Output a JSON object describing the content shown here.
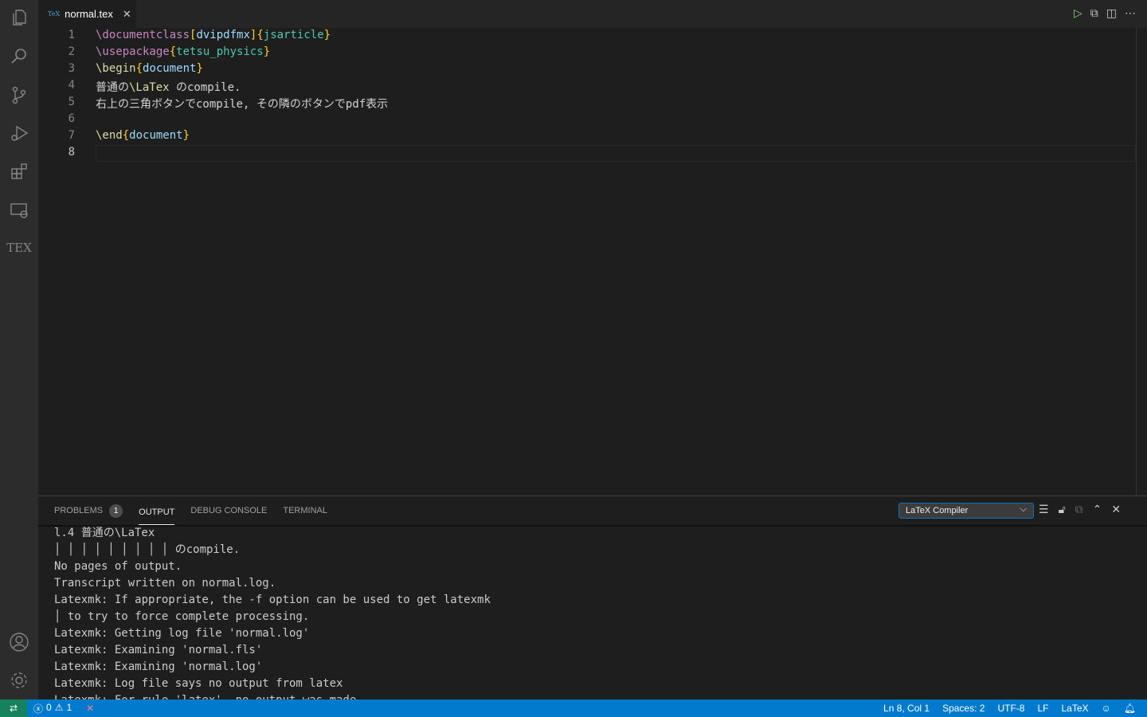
{
  "activity_bar": {
    "items": [
      "files-icon",
      "search-icon",
      "source-control-icon",
      "run-debug-icon",
      "extensions-icon",
      "remote-explorer-icon",
      "tex-icon"
    ],
    "bottom": [
      "account-icon",
      "settings-gear-icon"
    ],
    "tex_label": "TEX"
  },
  "tab": {
    "label": "normal.tex",
    "icon_text": "TeX"
  },
  "editor": {
    "current_line": 8,
    "lines": [
      [
        {
          "t": "\\documentclass",
          "c": "#c586c0"
        },
        {
          "t": "[",
          "c": "#ffd700"
        },
        {
          "t": "dvipdfmx",
          "c": "#9cdcfe"
        },
        {
          "t": "]",
          "c": "#ffd700"
        },
        {
          "t": "{",
          "c": "#ffd700"
        },
        {
          "t": "jsarticle",
          "c": "#4ec9b0"
        },
        {
          "t": "}",
          "c": "#ffd700"
        }
      ],
      [
        {
          "t": "\\usepackage",
          "c": "#c586c0"
        },
        {
          "t": "{",
          "c": "#ffd700"
        },
        {
          "t": "tetsu_physics",
          "c": "#4ec9b0"
        },
        {
          "t": "}",
          "c": "#ffd700"
        }
      ],
      [
        {
          "t": "\\begin",
          "c": "#dcdcaa"
        },
        {
          "t": "{",
          "c": "#ffd700"
        },
        {
          "t": "document",
          "c": "#9cdcfe"
        },
        {
          "t": "}",
          "c": "#ffd700"
        }
      ],
      [
        {
          "t": "普通の",
          "c": "#d4d4d4"
        },
        {
          "t": "\\LaTex",
          "c": "#dcdcaa"
        },
        {
          "t": " のcompile.",
          "c": "#d4d4d4"
        }
      ],
      [
        {
          "t": "右上の三角ボタンでcompile, その隣のボタンでpdf表示",
          "c": "#d4d4d4"
        }
      ],
      [],
      [
        {
          "t": "\\end",
          "c": "#dcdcaa"
        },
        {
          "t": "{",
          "c": "#ffd700"
        },
        {
          "t": "document",
          "c": "#9cdcfe"
        },
        {
          "t": "}",
          "c": "#ffd700"
        }
      ],
      []
    ]
  },
  "panel": {
    "tabs": [
      {
        "label": "PROBLEMS",
        "badge": "1"
      },
      {
        "label": "OUTPUT"
      },
      {
        "label": "DEBUG CONSOLE"
      },
      {
        "label": "TERMINAL"
      }
    ],
    "active_tab": "OUTPUT",
    "channel": "LaTeX Compiler",
    "output": [
      "l.4 普通の\\LaTex",
      "│ │ │ │ │ │ │ │ │ のcompile.",
      "No pages of output.",
      "Transcript written on normal.log.",
      "Latexmk: If appropriate, the -f option can be used to get latexmk",
      "│ to try to force complete processing.",
      "Latexmk: Getting log file 'normal.log'",
      "Latexmk: Examining 'normal.fls'",
      "Latexmk: Examining 'normal.log'",
      "Latexmk: Log file says no output from latex",
      "Latexmk: For rule 'latex', no output was made"
    ]
  },
  "status": {
    "errors": "0",
    "warnings": "1",
    "position": "Ln 8, Col 1",
    "spaces": "Spaces: 2",
    "encoding": "UTF-8",
    "eol": "LF",
    "language": "LaTeX"
  },
  "colors": {
    "status_bar": "#007acc",
    "remote": "#16825d",
    "accent": "#0e70c0"
  }
}
